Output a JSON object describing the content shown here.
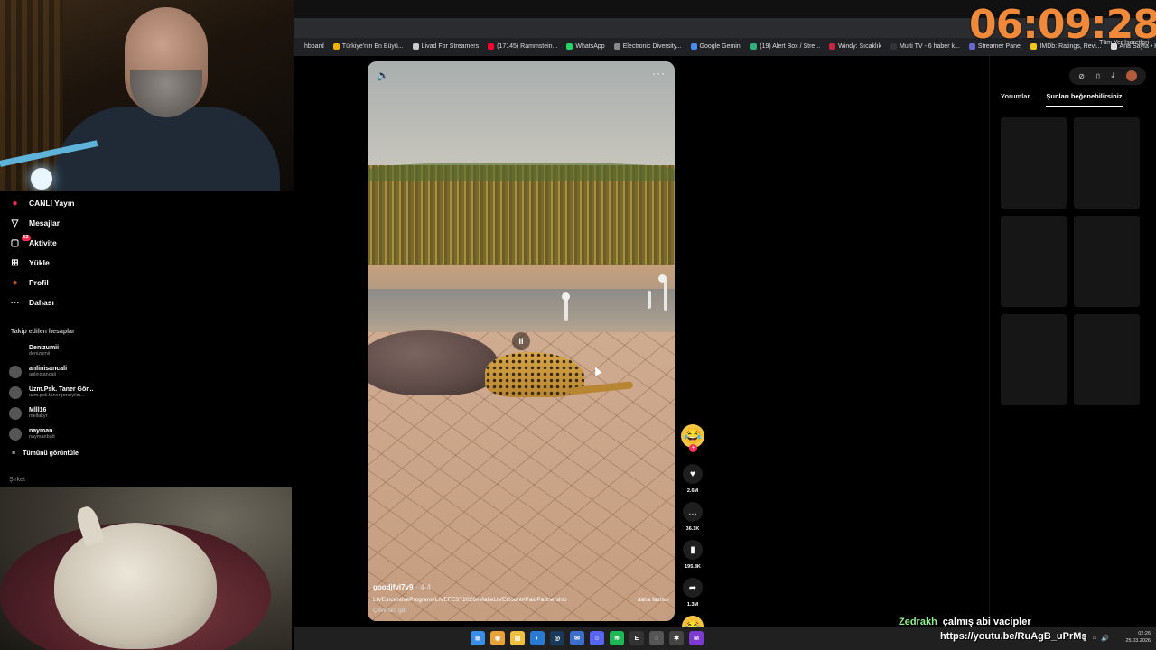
{
  "clock": "06:09:28",
  "bookmarks": [
    {
      "label": "hboard",
      "color": "#202124"
    },
    {
      "label": "Türkiye'nin En Büyü...",
      "color": "#f0b400"
    },
    {
      "label": "Livad For Streamers",
      "color": "#cccccc"
    },
    {
      "label": "(17145) Rammstein...",
      "color": "#ff0033"
    },
    {
      "label": "WhatsApp",
      "color": "#25d366"
    },
    {
      "label": "Electronic Diversity...",
      "color": "#888888"
    },
    {
      "label": "Google Gemini",
      "color": "#4a8af4"
    },
    {
      "label": "(19) Alert Box / Stre...",
      "color": "#30b07a"
    },
    {
      "label": "Windy: Sıcaklık",
      "color": "#cc2244"
    },
    {
      "label": "Multi TV - 6 haber k...",
      "color": "#333333"
    },
    {
      "label": "Streamer Panel",
      "color": "#6666cc"
    },
    {
      "label": "IMDb: Ratings, Revi...",
      "color": "#f5c518"
    },
    {
      "label": "Ana Sayfa • HBO Max",
      "color": "#dddddd"
    }
  ],
  "bookmarks_end": "Tüm Yer İşaretleri",
  "nav": {
    "items": [
      {
        "label": "CANLI Yayın",
        "icon": "live-icon",
        "glyph": "●",
        "color": "#fe2c55"
      },
      {
        "label": "Mesajlar",
        "icon": "send-icon",
        "glyph": "▽",
        "color": "#ffffff"
      },
      {
        "label": "Aktivite",
        "icon": "inbox-icon",
        "glyph": "▢",
        "color": "#ffffff",
        "badge": "53"
      },
      {
        "label": "Yükle",
        "icon": "upload-icon",
        "glyph": "⊞",
        "color": "#ffffff"
      },
      {
        "label": "Profil",
        "icon": "profile-icon",
        "glyph": "●",
        "color": "#c0582e"
      },
      {
        "label": "Dahası",
        "icon": "more-icon",
        "glyph": "⋯",
        "color": "#ffffff"
      }
    ],
    "following_title": "Takip edilen hesaplar",
    "following": [
      {
        "name": "Denizumii",
        "handle": "denizumii"
      },
      {
        "name": "anlinisancali",
        "handle": "anlinisancali"
      },
      {
        "name": "Uzm.Psk. Taner Gör...",
        "handle": "uzm.psk.tanergoruryilm..."
      },
      {
        "name": "Mlll16",
        "handle": "mellakyr"
      },
      {
        "name": "nayman",
        "handle": "naymanbatt"
      }
    ],
    "see_all": "Tümünü görüntüle",
    "company": "Şirket"
  },
  "video": {
    "author": "goodjfvl7y9",
    "author_time": "· 4-4",
    "hashtags": "LIVEIncentiveProgram#LIVEFEST2026#MakeLIVECount#PaidPartnership",
    "more": "daha fazlası",
    "translate": "Çevirisini gör",
    "pause_glyph": "II"
  },
  "rail": {
    "likes": "2.6M",
    "comments": "36.1K",
    "saves": "195.8K",
    "shares": "1.3M"
  },
  "right_panel": {
    "tabs": [
      "Yorumlar",
      "Şunları beğenebilirsiniz"
    ]
  },
  "chat": {
    "user": "Zedrakh",
    "message": "çalmış abi vacipler"
  },
  "url_overlay": "https://youtu.be/RuAgB_uPrMs",
  "tray": {
    "time": "02:26",
    "date": "25.03.2026"
  },
  "taskbar_apps": [
    {
      "icon": "windows-start-icon",
      "glyph": "⊞",
      "color": "#3a8ee6"
    },
    {
      "icon": "chrome-icon",
      "glyph": "◉",
      "color": "#e8a33a"
    },
    {
      "icon": "file-explorer-icon",
      "glyph": "▤",
      "color": "#f0c040"
    },
    {
      "icon": "edge-icon",
      "glyph": "◐",
      "color": "#2a7ad4"
    },
    {
      "icon": "steam-icon",
      "glyph": "◎",
      "color": "#1b3a5a"
    },
    {
      "icon": "mail-icon",
      "glyph": "✉",
      "color": "#3a6fd0"
    },
    {
      "icon": "discord-icon",
      "glyph": "☺",
      "color": "#5865f2"
    },
    {
      "icon": "spotify-icon",
      "glyph": "≋",
      "color": "#1db954"
    },
    {
      "icon": "epic-icon",
      "glyph": "E",
      "color": "#333333"
    },
    {
      "icon": "obs-icon",
      "glyph": "◌",
      "color": "#555555"
    },
    {
      "icon": "settings-icon",
      "glyph": "✱",
      "color": "#444444"
    },
    {
      "icon": "app-icon",
      "glyph": "M",
      "color": "#7b3ad0"
    }
  ]
}
